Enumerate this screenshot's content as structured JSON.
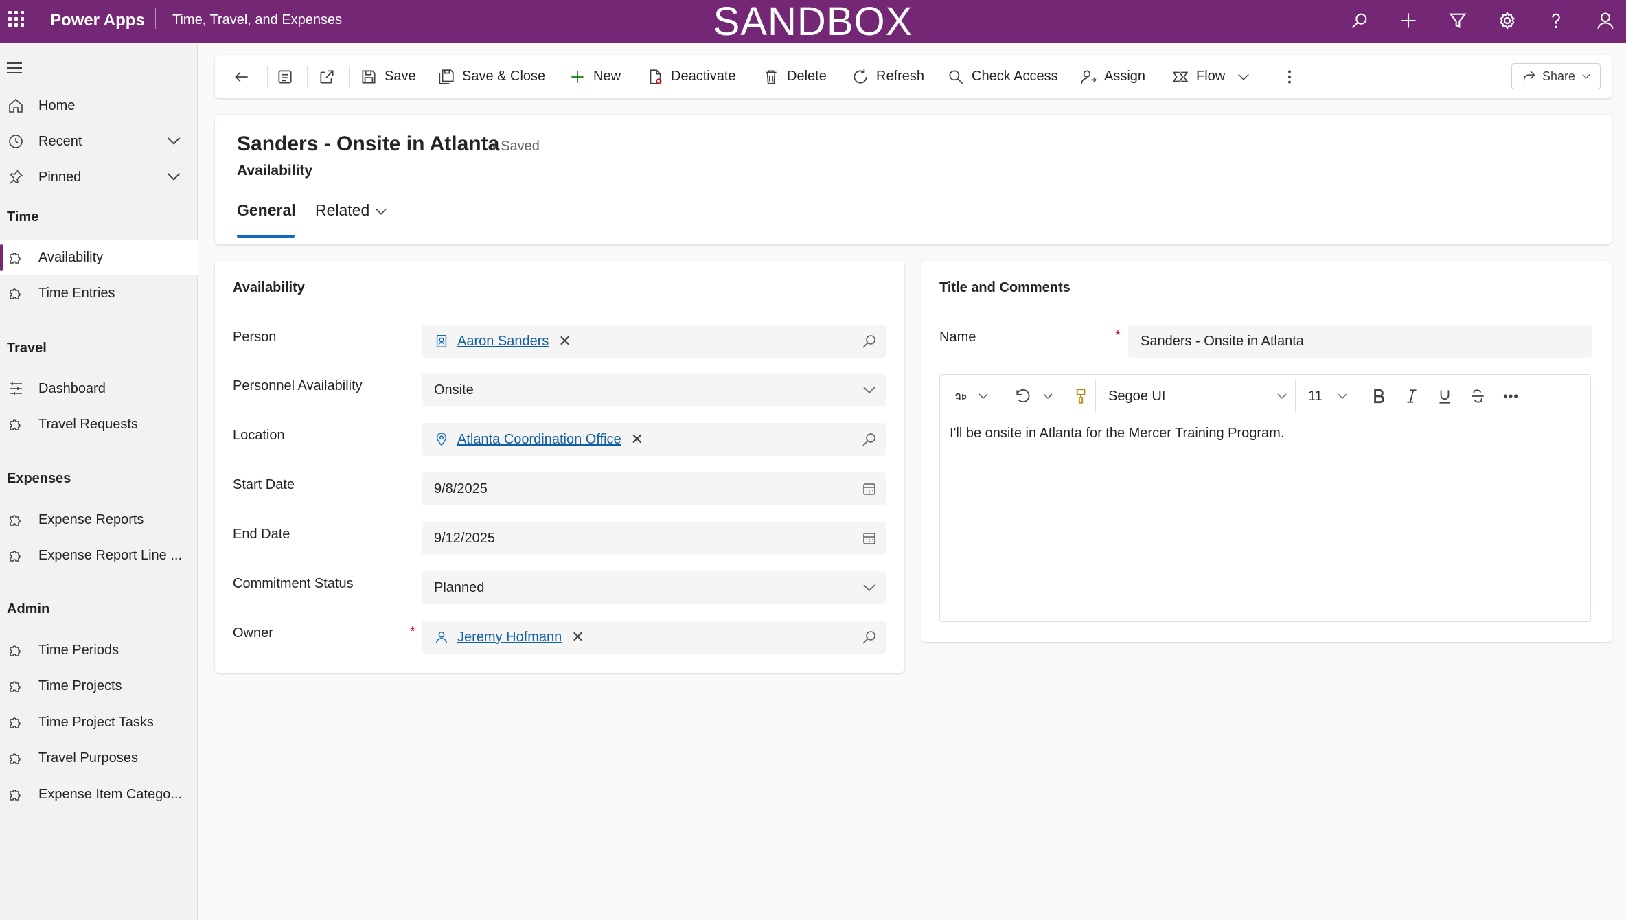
{
  "topbar": {
    "brand": "Power Apps",
    "app_name": "Time, Travel, and Expenses",
    "environment_banner": "SANDBOX"
  },
  "sidebar": {
    "home": "Home",
    "recent": "Recent",
    "pinned": "Pinned",
    "sections": [
      {
        "title": "Time",
        "items": [
          "Availability",
          "Time Entries"
        ]
      },
      {
        "title": "Travel",
        "items": [
          "Dashboard",
          "Travel Requests"
        ]
      },
      {
        "title": "Expenses",
        "items": [
          "Expense Reports",
          "Expense Report Line ..."
        ]
      },
      {
        "title": "Admin",
        "items": [
          "Time Periods",
          "Time Projects",
          "Time Project Tasks",
          "Travel Purposes",
          "Expense Item Catego..."
        ]
      }
    ],
    "selected": "Availability"
  },
  "commandbar": {
    "save": "Save",
    "save_close": "Save & Close",
    "new": "New",
    "deactivate": "Deactivate",
    "delete": "Delete",
    "refresh": "Refresh",
    "check_access": "Check Access",
    "assign": "Assign",
    "flow": "Flow",
    "share": "Share"
  },
  "record": {
    "title": "Sanders - Onsite in Atlanta",
    "saved_status": "- Saved",
    "entity": "Availability",
    "tabs": [
      "General",
      "Related"
    ],
    "active_tab": "General"
  },
  "availability_section": {
    "title": "Availability",
    "fields": {
      "person": {
        "label": "Person",
        "value": "Aaron Sanders"
      },
      "personnel_availability": {
        "label": "Personnel Availability",
        "value": "Onsite"
      },
      "location": {
        "label": "Location",
        "value": "Atlanta Coordination Office"
      },
      "start_date": {
        "label": "Start Date",
        "value": "9/8/2025"
      },
      "end_date": {
        "label": "End Date",
        "value": "9/12/2025"
      },
      "commitment_status": {
        "label": "Commitment Status",
        "value": "Planned"
      },
      "owner": {
        "label": "Owner",
        "value": "Jeremy Hofmann",
        "required_mark": "*"
      }
    }
  },
  "comments_section": {
    "title": "Title and Comments",
    "name": {
      "label": "Name",
      "value": "Sanders - Onsite in Atlanta",
      "required_mark": "*"
    },
    "editor": {
      "font": "Segoe UI",
      "size": "11",
      "content": "I'll be onsite in Atlanta for the Mercer Training Program."
    }
  },
  "colors": {
    "topbar": "#742774",
    "accent": "#0f6cbd",
    "link": "#115ea3",
    "required": "#c50f1f"
  }
}
